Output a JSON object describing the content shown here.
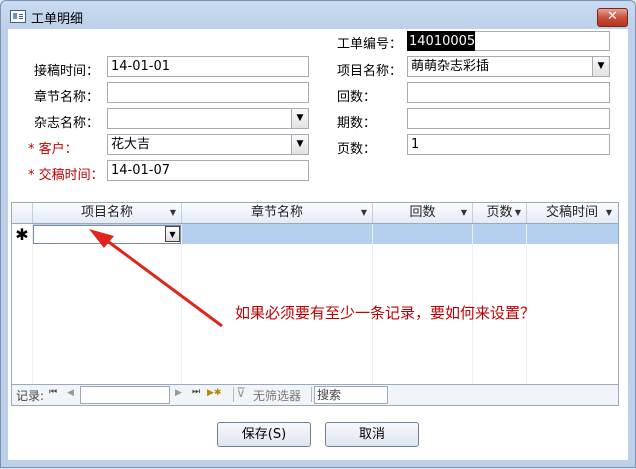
{
  "window": {
    "title": "工单明细",
    "close_label": "✕"
  },
  "form": {
    "order_no": {
      "label": "工单编号：",
      "value": "14010005"
    },
    "submit_time": {
      "label": "接稿时间：",
      "value": "14-01-01"
    },
    "project_name": {
      "label": "项目名称：",
      "value": "萌萌杂志彩插"
    },
    "chapter_name": {
      "label": "章节名称：",
      "value": ""
    },
    "episode": {
      "label": "回数：",
      "value": ""
    },
    "magazine_name": {
      "label": "杂志名称：",
      "value": ""
    },
    "issue": {
      "label": "期数：",
      "value": ""
    },
    "customer": {
      "label": "* 客户：",
      "value": "花大吉"
    },
    "pages": {
      "label": "页数：",
      "value": "1"
    },
    "delivery_time": {
      "label": "* 交稿时间：",
      "value": "14-01-07"
    }
  },
  "subgrid": {
    "columns": [
      "项目名称",
      "章节名称",
      "回数",
      "页数",
      "交稿时间"
    ],
    "new_row_marker": "✱",
    "nav": {
      "record_label": "记录:",
      "first": "⏮",
      "prev": "◀",
      "next": "▶",
      "last": "⏭",
      "new": "▶✱",
      "filter_label": "无筛选器",
      "search_label": "搜索"
    }
  },
  "annotation": "如果必须要有至少一条记录，要如何来设置？",
  "buttons": {
    "save": "保存(S)",
    "cancel": "取消"
  },
  "colors": {
    "required": "#c00000",
    "row_highlight": "#b5d0ef",
    "annotation": "#c00000"
  },
  "icons": [
    "form-icon",
    "close-icon",
    "dropdown-icon",
    "filter-icon",
    "arrow-annotation"
  ]
}
